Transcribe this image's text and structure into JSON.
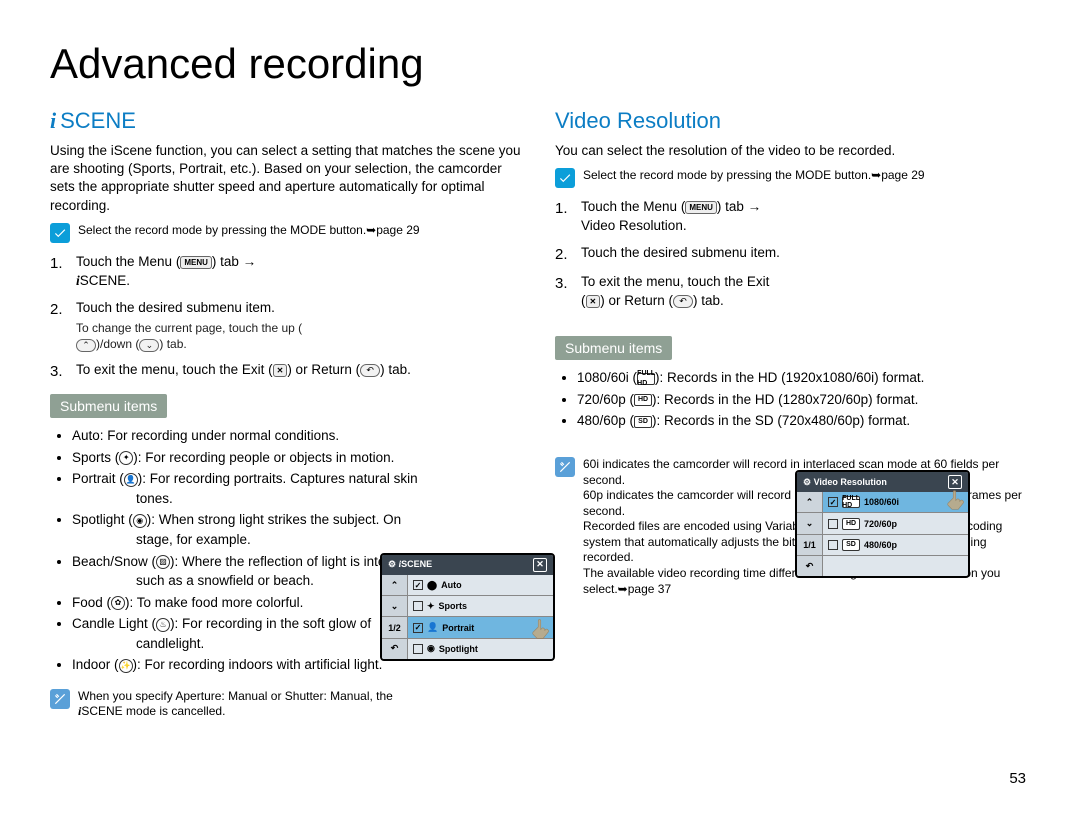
{
  "page": {
    "title": "Advanced recording",
    "number": "53"
  },
  "left": {
    "heading": "SCENE",
    "intro": "Using the iScene function, you can select a setting that matches the scene you are shooting (Sports, Portrait, etc.). Based on your selection, the camcorder sets the appropriate shutter speed and aperture automatically for optimal recording.",
    "note1": "Select the record mode by pressing the MODE button.➥page 29",
    "step1_a": "Touch the Menu (",
    "step1_b": ") tab →",
    "step1_c": "SCENE.",
    "step2": "Touch the desired submenu item.",
    "step2_sub": "To change the current page, touch the up (",
    "step2_sub_b": ")/down (",
    "step2_sub_c": ") tab.",
    "step3_a": "To exit the menu, touch the Exit (",
    "step3_b": ") or Return (",
    "step3_c": ") tab.",
    "submenu_title": "Submenu items",
    "bullets": {
      "auto": "Auto: For recording under normal conditions.",
      "sports": "Sports (",
      "sports_b": "): For recording people or objects in motion.",
      "portrait": "Portrait (",
      "portrait_b": "): For recording portraits. Captures natural skin",
      "portrait_cont": "tones.",
      "spotlight": "Spotlight (",
      "spotlight_b": "): When strong light strikes the subject. On",
      "spotlight_cont": "stage, for example.",
      "beach": "Beach/Snow (",
      "beach_b": "): Where the reflection of light is intense",
      "beach_cont": "such as a snowfield or beach.",
      "food": "Food (",
      "food_b": "): To make food more colorful.",
      "candle": "Candle Light (",
      "candle_b": "): For recording in the soft glow of",
      "candle_cont": "candlelight.",
      "indoor": "Indoor (",
      "indoor_b": "): For recording indoors with artificial light."
    },
    "note2_a": "When you specify  Aperture: Manual  or  Shutter: Manual,  the",
    "note2_b": "SCENE mode is cancelled.",
    "lcd": {
      "title": "SCENE",
      "row1": "Auto",
      "row2": "Sports",
      "row3": "Portrait",
      "row4": "Spotlight",
      "side_page": "1/2"
    }
  },
  "right": {
    "heading": "Video Resolution",
    "intro": "You can select the resolution of the video to be recorded.",
    "note1": "Select the record mode by pressing the MODE button.➥page 29",
    "step1_a": "Touch the Menu (",
    "step1_b": ") tab →",
    "step1_c": "Video Resolution.",
    "step2": "Touch the desired submenu item.",
    "step3_a": "To exit the menu, touch the Exit",
    "step3_b": "(",
    "step3_c": ") or Return (",
    "step3_d": ") tab.",
    "submenu_title": "Submenu items",
    "bullets": {
      "b1_a": "1080/60i (",
      "b1_b": "): Records in the HD (1920x1080/60i) format.",
      "b2_a": "720/60p (",
      "b2_b": "): Records in the HD (1280x720/60p) format.",
      "b3_a": "480/60p (",
      "b3_b": "): Records in the SD (720x480/60p) format."
    },
    "note2": {
      "l1": " 60i  indicates the camcorder will record in interlaced scan mode at 60 fields per second.",
      "l2": " 60p  indicates the camcorder will record in progressive scan mode at 60 frames per second.",
      "l3": "Recorded files are encoded using Variable Bit Rate (VBR). VBR is an encoding system that automatically adjusts the bit rate in response to the image being recorded.",
      "l4": "The available video recording time differs according to the video resolution you select.➥page 37"
    },
    "lcd": {
      "title": "Video Resolution",
      "row1": "1080/60i",
      "row2": "720/60p",
      "row3": "480/60p",
      "side_page": "1/1",
      "hd_full": "FULL HD",
      "hd": "HD",
      "sd": "SD"
    }
  },
  "icons": {
    "menu": "MENU",
    "up": "«",
    "down": "»",
    "close": "✖",
    "return": "↩"
  }
}
